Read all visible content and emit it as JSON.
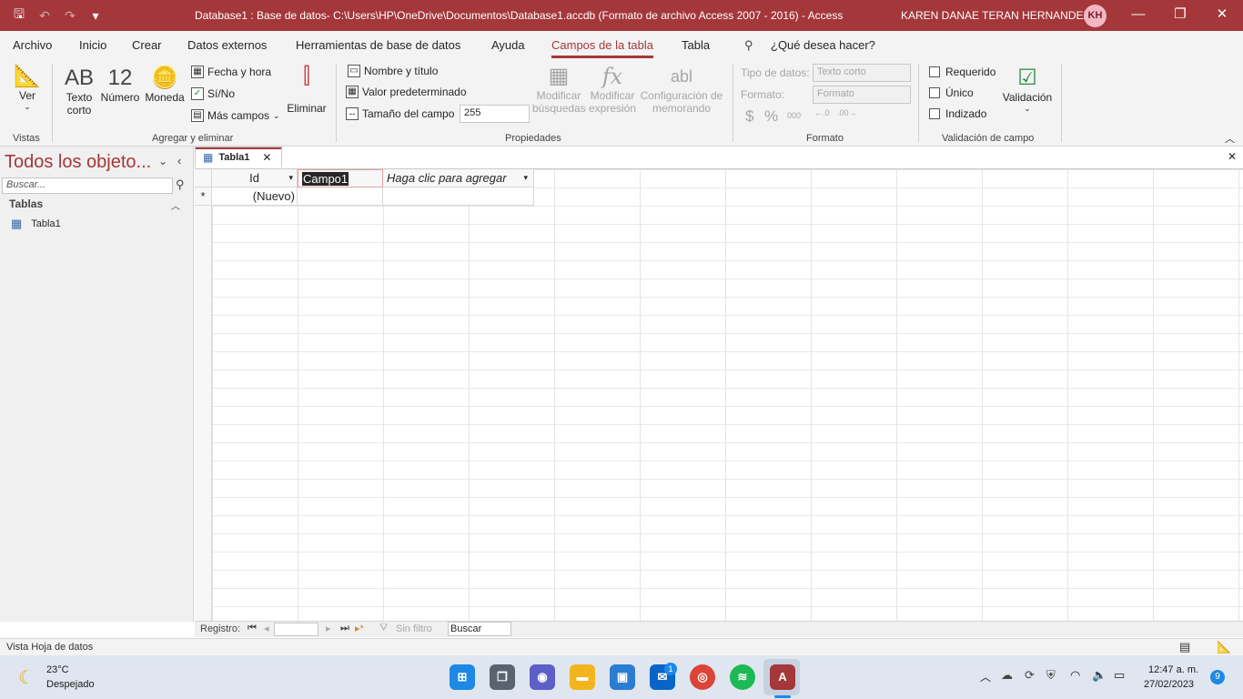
{
  "titlebar": {
    "title": "Database1 : Base de datos- C:\\Users\\HP\\OneDrive\\Documentos\\Database1.accdb (Formato de archivo Access 2007 - 2016)  -  Access",
    "user": "KAREN DANAE TERAN HERNANDEZ",
    "avatar_initials": "KH",
    "minimize": "—",
    "restore": "❐",
    "close": "✕"
  },
  "tabs": [
    "Archivo",
    "Inicio",
    "Crear",
    "Datos externos",
    "Herramientas de base de datos",
    "Ayuda",
    "Campos de la tabla",
    "Tabla"
  ],
  "active_tab": "Campos de la tabla",
  "tell_me": "¿Qué desea hacer?",
  "ribbon": {
    "vistas": {
      "ver": "Ver",
      "label": "Vistas"
    },
    "agregar": {
      "texto_corto_big": "AB",
      "texto_corto_l1": "Texto",
      "texto_corto_l2": "corto",
      "numero_big": "12",
      "numero": "Número",
      "moneda": "Moneda",
      "fecha_hora": "Fecha y hora",
      "si_no": "Sí/No",
      "mas_campos": "Más campos",
      "eliminar": "Eliminar",
      "label": "Agregar y eliminar"
    },
    "propiedades": {
      "nombre_titulo": "Nombre y título",
      "valor_predeterminado": "Valor predeterminado",
      "tamano_campo": "Tamaño del campo",
      "tamano_valor": "255",
      "mod_busquedas_l1": "Modificar",
      "mod_busquedas_l2": "búsquedas",
      "mod_expresion_l1": "Modificar",
      "mod_expresion_l2": "expresión",
      "config_memo_l1": "Configuración de",
      "config_memo_l2": "memorando",
      "label": "Propiedades"
    },
    "formato": {
      "tipo_datos_label": "Tipo de datos:",
      "tipo_datos_valor": "Texto corto",
      "formato_label": "Formato:",
      "formato_valor": "Formato",
      "currency": "$",
      "percent": "%",
      "thousands": "000",
      "label": "Formato"
    },
    "validacion": {
      "requerido": "Requerido",
      "unico": "Único",
      "indizado": "Indizado",
      "validacion": "Validación",
      "label": "Validación de campo"
    }
  },
  "navpane": {
    "title": "Todos los objeto...",
    "search_placeholder": "Buscar...",
    "section": "Tablas",
    "items": [
      "Tabla1"
    ]
  },
  "document": {
    "tab": "Tabla1",
    "columns": [
      "Id",
      "Campo1",
      "Haga clic para agregar"
    ],
    "new_row_marker": "*",
    "new_row_value": "(Nuevo)"
  },
  "recnav": {
    "label": "Registro:",
    "filter": "Sin filtro",
    "search": "Buscar"
  },
  "status": {
    "text": "Vista Hoja de datos"
  },
  "taskbar": {
    "weather_temp": "23°C",
    "weather_desc": "Despejado",
    "mail_badge": "1",
    "time": "12:47 a. m.",
    "date": "27/02/2023",
    "notif_count": "9"
  }
}
